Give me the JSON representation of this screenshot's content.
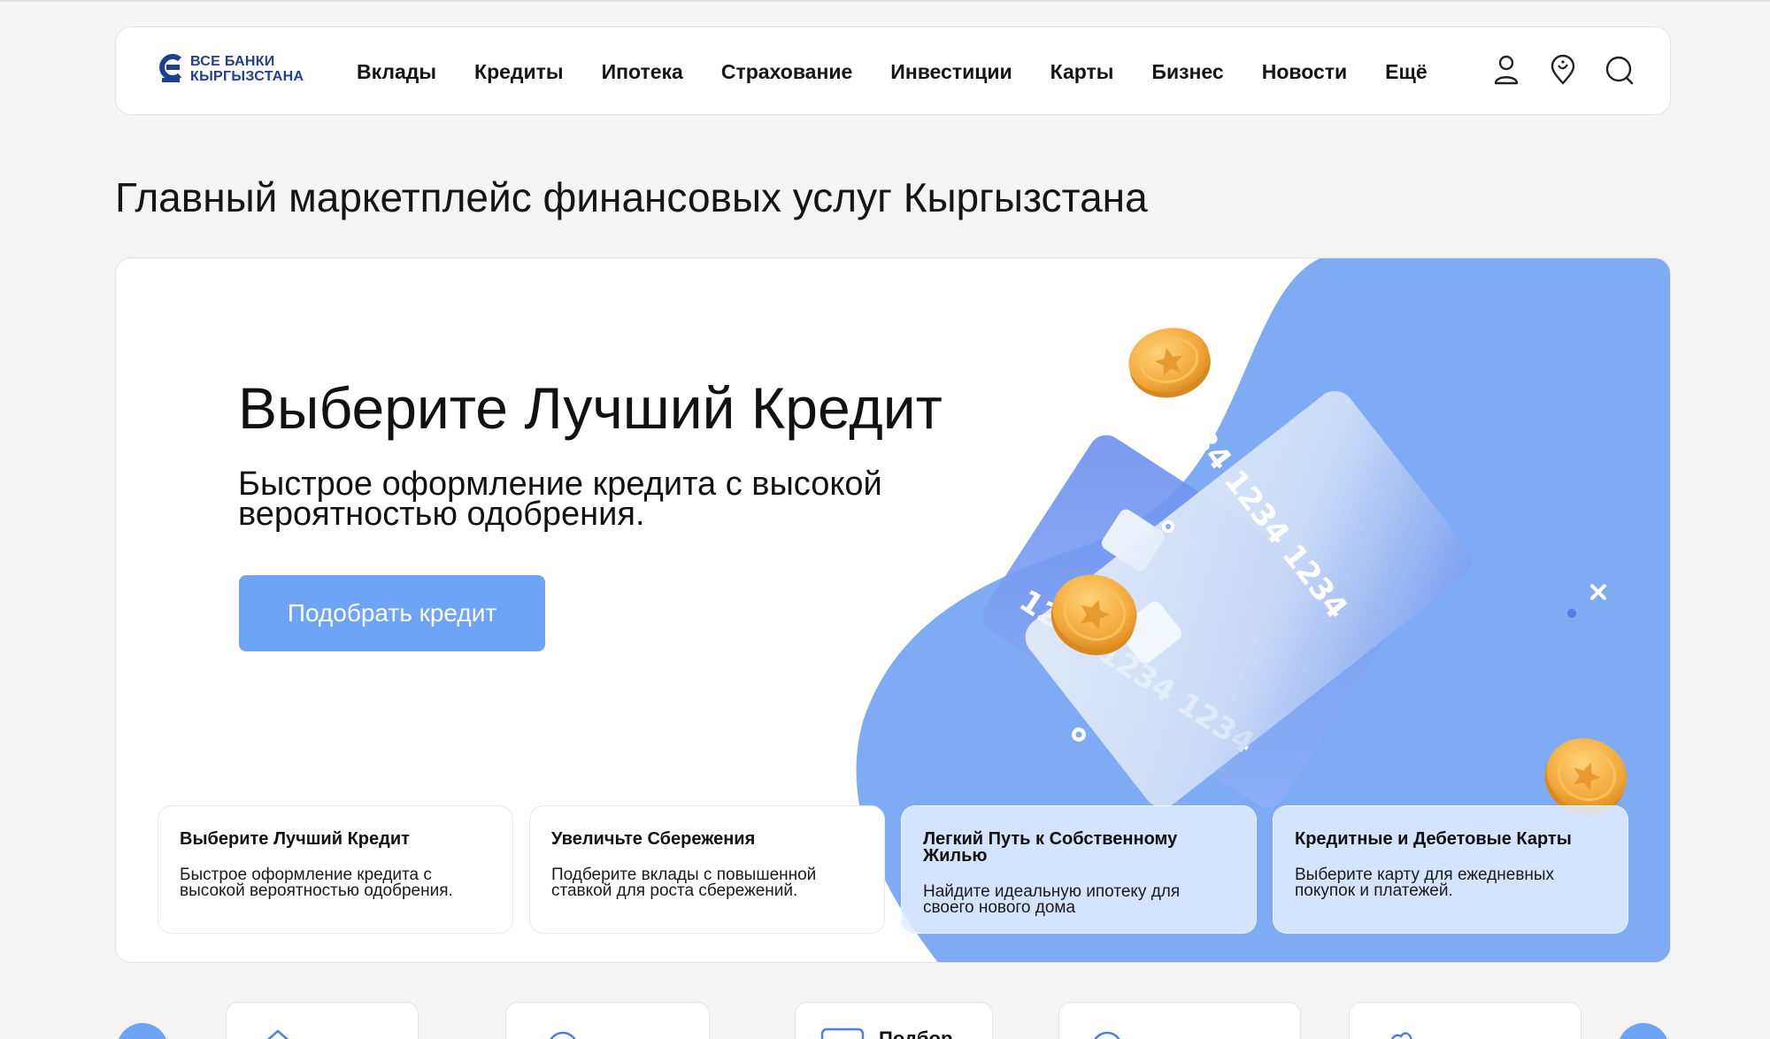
{
  "logo": {
    "line1": "ВСЕ БАНКИ",
    "line2": "КЫРГЫЗСТАНА",
    "brand_color": "#1f3f8f"
  },
  "nav": {
    "items": [
      {
        "label": "Вклады"
      },
      {
        "label": "Кредиты"
      },
      {
        "label": "Ипотека"
      },
      {
        "label": "Страхование"
      },
      {
        "label": "Инвестиции"
      },
      {
        "label": "Карты"
      },
      {
        "label": "Бизнес"
      },
      {
        "label": "Новости"
      },
      {
        "label": "Ещё"
      }
    ]
  },
  "header_icons": [
    "user-icon",
    "location-pin-icon",
    "search-icon"
  ],
  "page_title": "Главный маркетплейс финансовых услуг Кыргызстана",
  "hero": {
    "title": "Выберите Лучший Кредит",
    "subtitle": "Быстрое оформление кредита с высокой вероятностью одобрения.",
    "button_label": "Подобрать кредит",
    "card_number_text": "1234 1234 1234",
    "accent_color": "#6da4f5"
  },
  "feature_cards": [
    {
      "title": "Выберите Лучший Кредит",
      "desc": "Быстрое оформление кредита с высокой вероятностью одобрения."
    },
    {
      "title": "Увеличьте Сбережения",
      "desc": "Подберите вклады с повышенной ставкой для роста сбережений."
    },
    {
      "title": "Легкий Путь к Собственному Жилью",
      "desc": "Найдите идеальную ипотеку для своего нового дома"
    },
    {
      "title": "Кредитные и Дебетовые Карты",
      "desc": "Выберите карту для ежедневных покупок и платежей."
    }
  ],
  "bottom_cards": [
    {
      "label": ""
    },
    {
      "label": ""
    },
    {
      "label": "Подбор"
    },
    {
      "label": ""
    },
    {
      "label": ""
    }
  ]
}
